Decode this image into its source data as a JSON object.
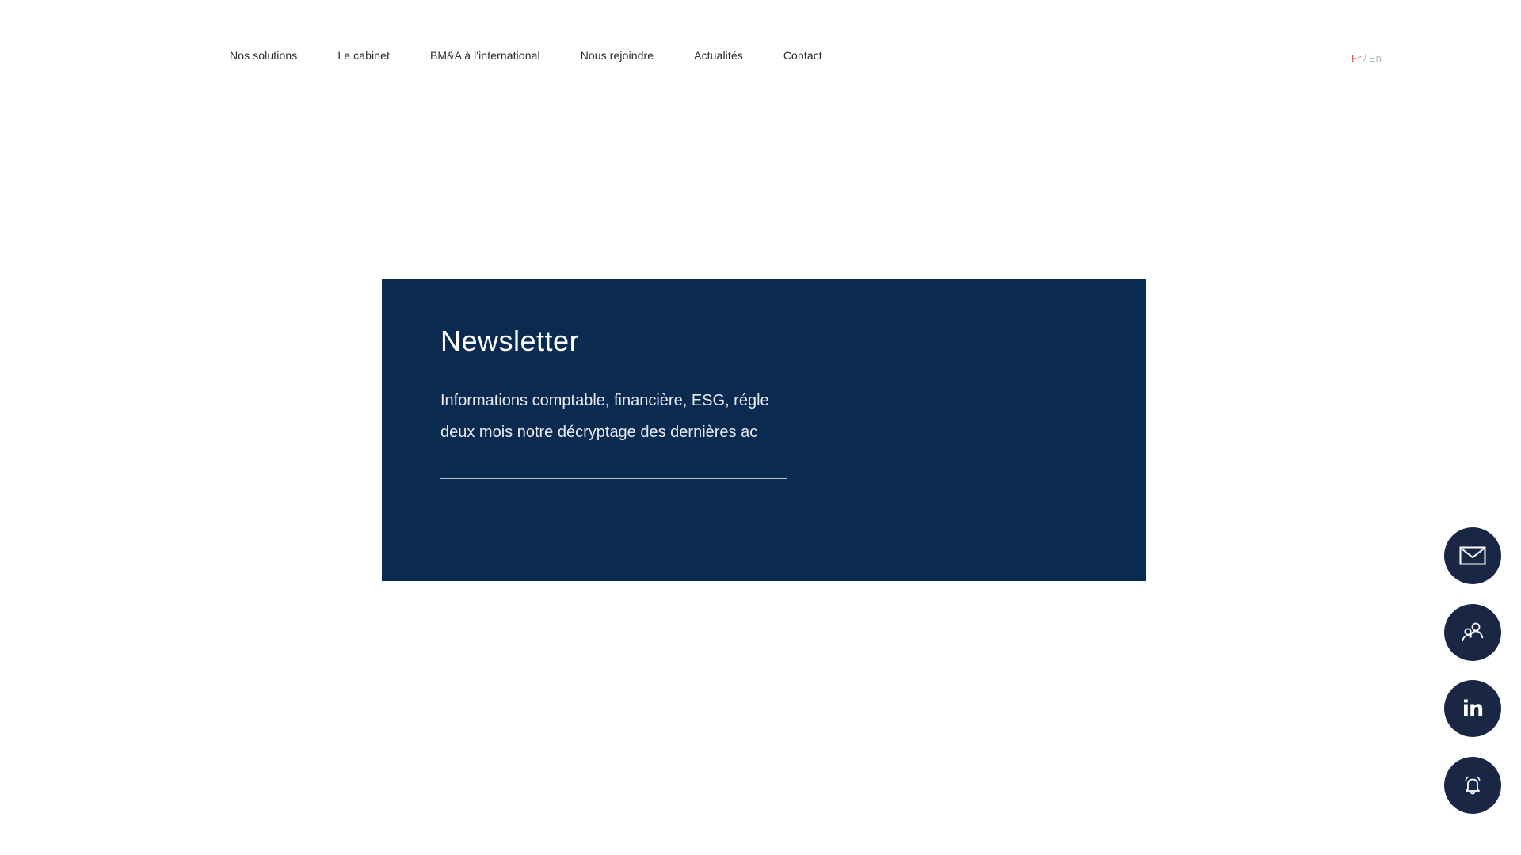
{
  "nav": {
    "items": [
      {
        "label": "Nos solutions"
      },
      {
        "label": "Le cabinet"
      },
      {
        "label": "BM&A à l'international"
      },
      {
        "label": "Nous rejoindre"
      },
      {
        "label": "Actualités"
      },
      {
        "label": "Contact"
      }
    ]
  },
  "language": {
    "active": "Fr",
    "separator": "/",
    "inactive": "En"
  },
  "newsletter": {
    "title": "Newsletter",
    "description": "Informations comptable, financière, ESG, réglementaire : recevez tous les deux mois notre décryptage des dernières actualités",
    "line1": "Informations comptable, financière, ESG, régle",
    "line2": "deux mois notre décryptage des dernières ac"
  },
  "floating_actions": [
    {
      "icon": "mail-icon"
    },
    {
      "icon": "users-icon"
    },
    {
      "icon": "linkedin-icon",
      "text": "in"
    },
    {
      "icon": "bell-icon"
    }
  ],
  "colors": {
    "panel_background": "#0a2a50",
    "fab_background": "#1a2744",
    "language_active": "#d8554d",
    "language_inactive": "#b8b8b8"
  }
}
